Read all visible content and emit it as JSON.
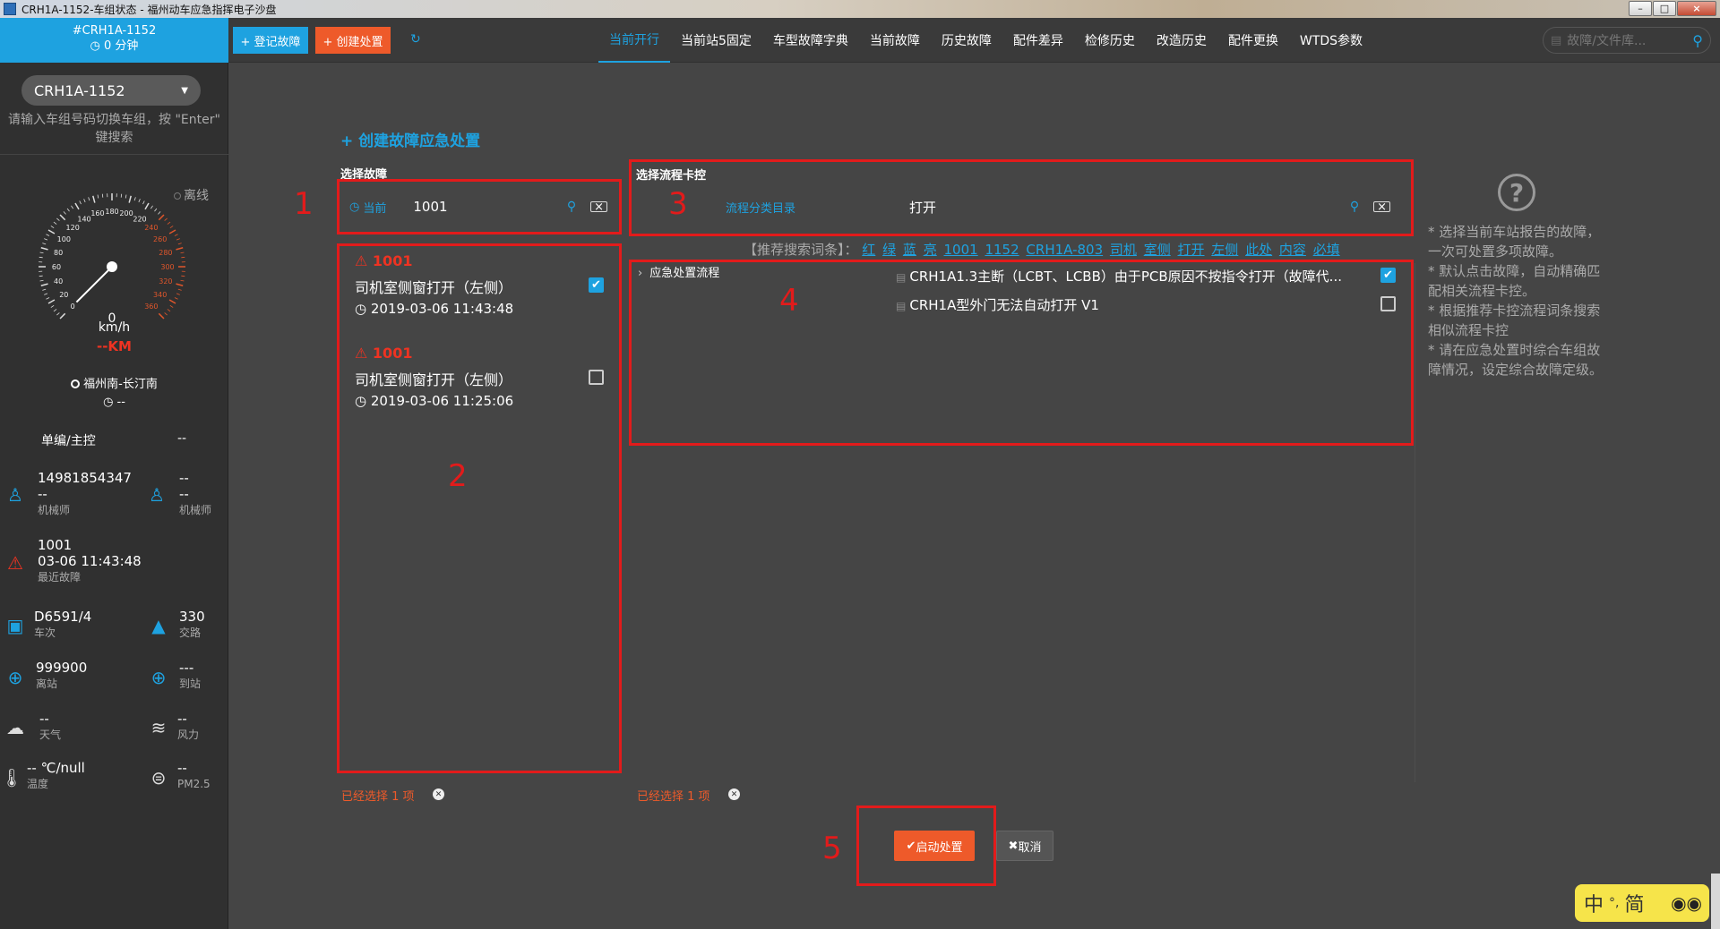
{
  "window": {
    "title": "CRH1A-1152-车组状态 - 福州动车应急指挥电子沙盘",
    "buttons": [
      "–",
      "□",
      "×"
    ]
  },
  "header": {
    "train_code": "#CRH1A-1152",
    "train_minutes": "0 分钟",
    "register_fault_label": "+ 登记故障",
    "create_handling_label": "+ 创建处置",
    "tabs": [
      "当前开行",
      "当前站5固定",
      "车型故障字典",
      "当前故障",
      "历史故障",
      "配件差异",
      "检修历史",
      "改造历史",
      "配件更换",
      "WTDS参数"
    ],
    "active_tab": 0,
    "search_placeholder": "故障/文件库..."
  },
  "sidebar": {
    "train_select": "CRH1A-1152",
    "hint": "请输入车组号码切换车组，按 \"Enter\" 键搜索",
    "offline": "离线",
    "gauge_ticks": [
      "0",
      "20",
      "40",
      "60",
      "80",
      "100",
      "120",
      "140",
      "160",
      "180",
      "200",
      "220",
      "240",
      "260",
      "280",
      "300",
      "320",
      "340",
      "360"
    ],
    "speed_value": "0",
    "speed_unit": "km/h",
    "km": "--KM",
    "route": "福州南-长汀南",
    "timer": "--",
    "mode_label": "单编/主控",
    "mode_value": "--",
    "driver1_phone": "14981854347",
    "driver1_name": "--",
    "driver1_label": "机械师",
    "driver2_phone": "--",
    "driver2_name": "--",
    "driver2_label": "机械师",
    "last_fault_code": "1001",
    "last_fault_time": "03-06 11:43:48",
    "last_fault_label": "最近故障",
    "train_no": "D6591/4",
    "train_no_label": "车次",
    "route_no": "330",
    "route_no_label": "交路",
    "depart_station": "999900",
    "depart_label": "离站",
    "arrive_station": "---",
    "arrive_label": "到站",
    "weather": "--",
    "weather_label": "天气",
    "wind": "--",
    "wind_label": "风力",
    "temperature": "-- ℃/null",
    "temperature_label": "温度",
    "pm25": "--",
    "pm25_label": "PM2.5"
  },
  "main": {
    "title": "+ 创建故障应急处置",
    "fault_section_label": "选择故障",
    "fault_search_label": "当前",
    "fault_search_value": "1001",
    "faults": [
      {
        "code": "1001",
        "desc": "司机室侧窗打开（左侧）",
        "time": "2019-03-06 11:43:48",
        "checked": true
      },
      {
        "code": "1001",
        "desc": "司机室侧窗打开（左侧）",
        "time": "2019-03-06 11:25:06",
        "checked": false
      }
    ],
    "fault_selected": "已经选择 1 项",
    "flow_section_label": "选择流程卡控",
    "flow_category_label": "流程分类目录",
    "flow_search_value": "打开",
    "tags_prefix": "【推荐搜索词条】：",
    "tags": [
      "红",
      "绿",
      "蓝",
      "亮",
      "1001",
      "1152",
      "CRH1A-803",
      "司机",
      "室侧",
      "打开",
      "左侧",
      "此处",
      "内容",
      "必填"
    ],
    "tree_root": "应急处置流程",
    "flows": [
      {
        "name": "CRH1A1.3主断（LCBT、LCBB）由于PCB原因不按指令打开（故障代...",
        "checked": true
      },
      {
        "name": "CRH1A型外门无法自动打开 V1",
        "checked": false
      }
    ],
    "flow_selected": "已经选择 1 项",
    "help_lines": [
      "* 选择当前车站报告的故障，一次可处置多项故障。",
      "* 默认点击故障，自动精确匹配相关流程卡控。",
      "* 根据推荐卡控流程词条搜索相似流程卡控",
      "* 请在应急处置时综合车组故障情况，设定综合故障定级。"
    ],
    "start_label": "启动处置",
    "cancel_label": "取消"
  },
  "annotations": [
    "1",
    "2",
    "3",
    "4",
    "5"
  ],
  "ime": {
    "lang": "中",
    "mode": "简"
  },
  "colors": {
    "accent": "#1ea2e0",
    "danger": "#ee3322",
    "orange": "#ee5a2a",
    "annotation": "#e21b1b"
  }
}
